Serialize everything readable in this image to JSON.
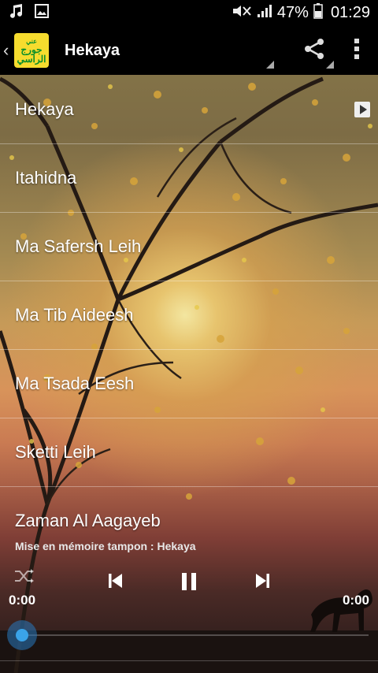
{
  "status_bar": {
    "battery": "47%",
    "time": "01:29"
  },
  "action_bar": {
    "title": "Hekaya",
    "logo_text_line1": "عني",
    "logo_text_line2": "جورج",
    "logo_text_line3": "الراسي"
  },
  "songs": [
    {
      "title": "Hekaya"
    },
    {
      "title": "Itahidna"
    },
    {
      "title": "Ma Safersh Leih"
    },
    {
      "title": "Ma Tib Aideesh"
    },
    {
      "title": "Ma Tsada Eesh"
    },
    {
      "title": "Sketti Leih"
    },
    {
      "title": "Zaman Al Aagayeb"
    }
  ],
  "player": {
    "cache_status": "Mise en mémoire tampon : Hekaya",
    "elapsed": "0:00",
    "duration": "0:00",
    "progress": 0
  },
  "colors": {
    "bar_bg": "#000000",
    "logo_bg": "#f6dc2e",
    "logo_text": "#0a8f2a",
    "seek_knob": "#3aa3e8"
  },
  "icons": [
    "music-note-icon",
    "image-icon",
    "mute-icon",
    "signal-icon",
    "battery-icon",
    "share-icon",
    "overflow-menu-icon",
    "play-icon",
    "shuffle-icon",
    "previous-icon",
    "pause-icon",
    "next-icon"
  ]
}
